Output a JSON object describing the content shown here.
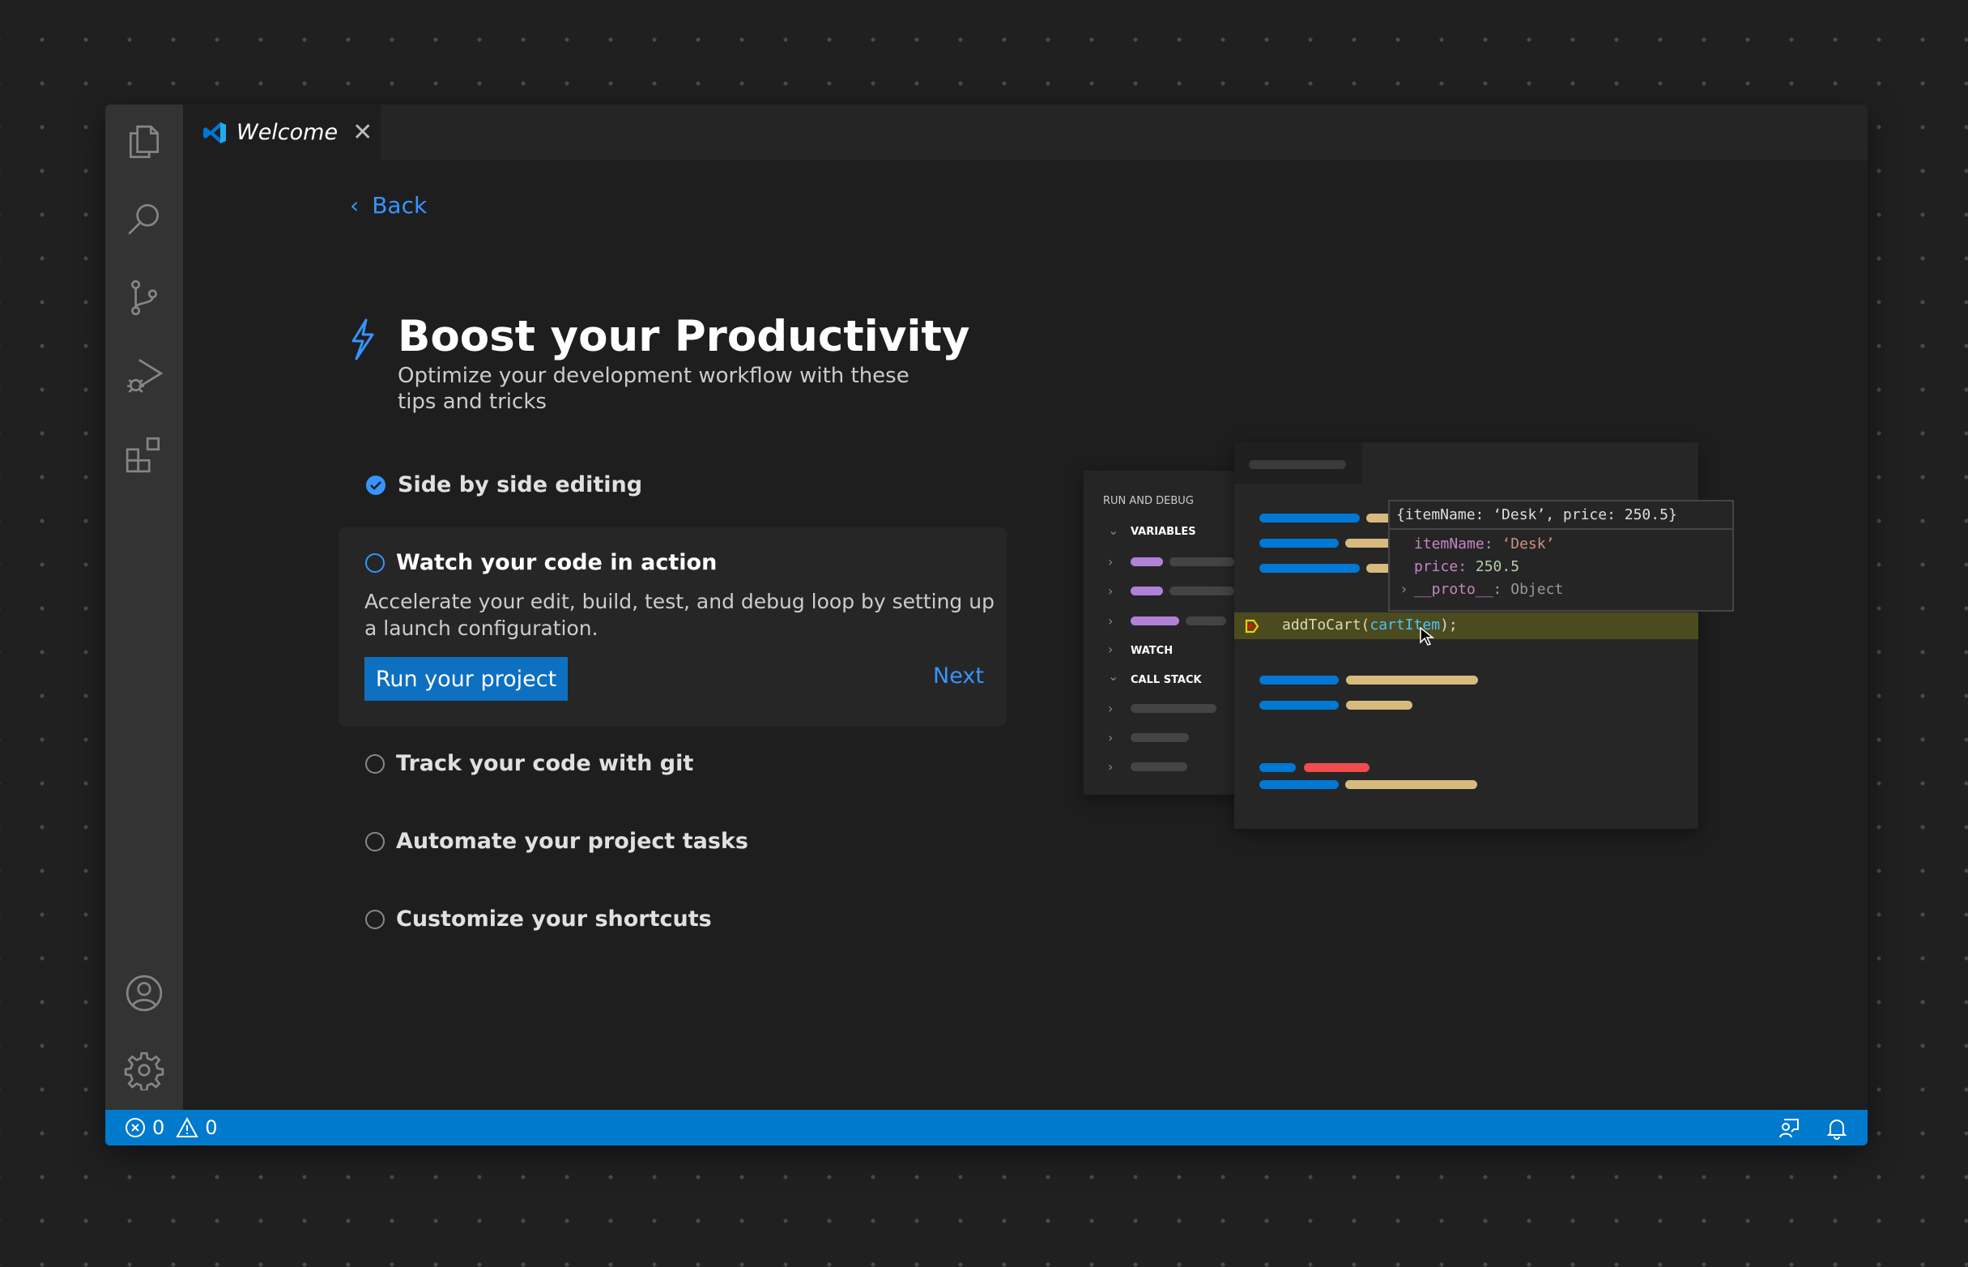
{
  "tab": {
    "title": "Welcome",
    "close_icon": "close-icon"
  },
  "activity_bar": [
    "explorer-icon",
    "search-icon",
    "source-control-icon",
    "run-debug-icon",
    "extensions-icon",
    "account-icon",
    "settings-gear-icon"
  ],
  "editor_actions": [
    "split-editor-icon",
    "more-actions-icon"
  ],
  "page": {
    "back": "Back",
    "title": "Boost your Productivity",
    "subtitle": "Optimize your development workflow with these tips and tricks"
  },
  "steps": [
    {
      "label": "Side by side editing",
      "done": true
    },
    {
      "label": "Watch your code in action",
      "done": false,
      "description": "Accelerate your edit, build, test, and debug loop by setting up a launch configuration.",
      "button": "Run your project",
      "next": "Next"
    },
    {
      "label": "Track your code with git",
      "done": false
    },
    {
      "label": "Automate your project tasks",
      "done": false
    },
    {
      "label": "Customize your shortcuts",
      "done": false
    }
  ],
  "illustration": {
    "panel_title": "RUN AND DEBUG",
    "variables": "VARIABLES",
    "watch": "WATCH",
    "call_stack": "CALL STACK",
    "hover_header": "{itemName: ‘Desk’, price: 250.5}",
    "hover_lines": [
      {
        "key": "itemName",
        "value": "‘Desk’"
      },
      {
        "key": "price",
        "value": "250.5"
      },
      {
        "key": "__proto__",
        "value": "Object"
      }
    ],
    "code_fn": "addToCart(",
    "code_arg": "cartItem",
    "code_end": ");"
  },
  "status": {
    "errors": "0",
    "warnings": "0"
  },
  "colors": {
    "accent": "#007acc",
    "link": "#3794ff",
    "highlight": "#4b4b1f"
  }
}
